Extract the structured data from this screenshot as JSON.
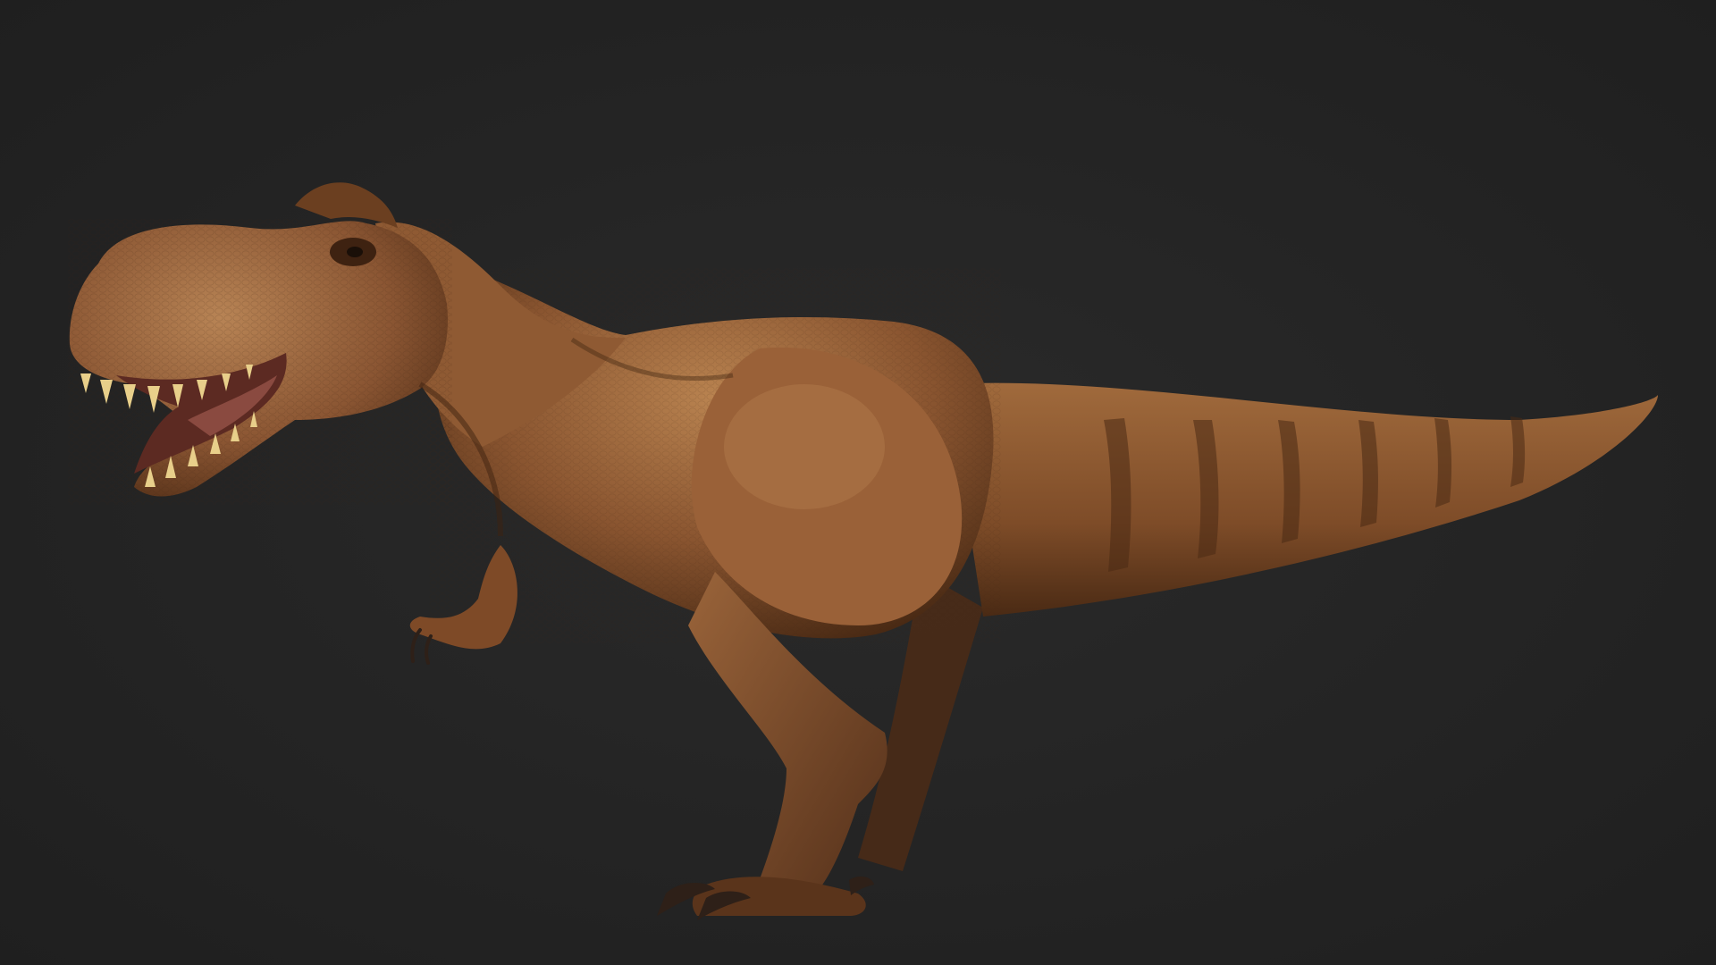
{
  "scene": {
    "subject": "tyrannosaurus-rex",
    "background_color": "#232323",
    "palette": {
      "skin_base": "#8a5530",
      "skin_light": "#b07a48",
      "skin_dark": "#4a2a14",
      "stripe": "#5a3418",
      "teeth": "#e8cf8a",
      "mouth": "#5c2a22",
      "claw": "#3a2a20"
    }
  }
}
